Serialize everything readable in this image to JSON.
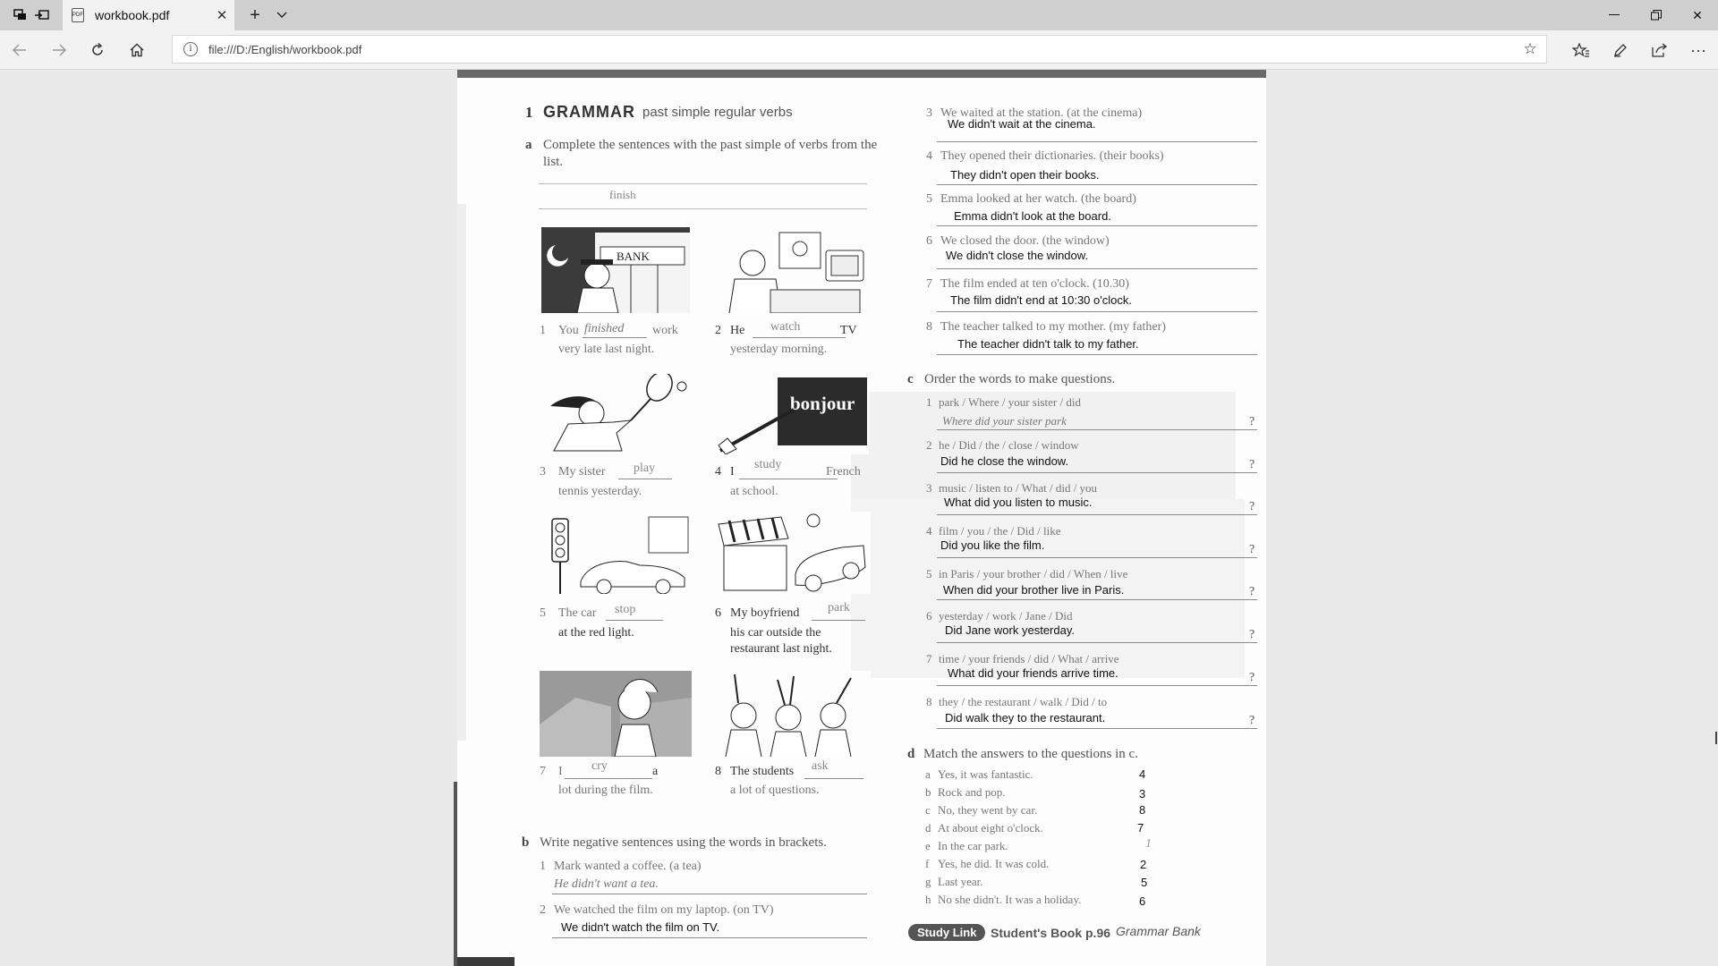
{
  "browser": {
    "tab_title": "workbook.pdf",
    "tab_favicon_text": "PDF",
    "url": "file:///D:/English/workbook.pdf"
  },
  "page": {
    "section1": {
      "number": "1",
      "heading": "GRAMMAR",
      "subheading": "past simple regular verbs",
      "part_a": {
        "letter": "a",
        "instruction": "Complete the sentences with the past simple of verbs from the list.",
        "word_box": [
          "finish"
        ],
        "items": [
          {
            "num": "1",
            "pre": "You",
            "fill": "finished",
            "post": "work",
            "line2": "very late last night."
          },
          {
            "num": "2",
            "pre": "He",
            "fill": "watch",
            "post": "TV",
            "line2": "yesterday morning."
          },
          {
            "num": "3",
            "pre": "My sister",
            "fill": "play",
            "post": "",
            "line2": "tennis yesterday."
          },
          {
            "num": "4",
            "pre": "I",
            "fill": "study",
            "post": "French",
            "line2": "at school."
          },
          {
            "num": "5",
            "pre": "The car",
            "fill": "stop",
            "post": "",
            "line2": "at the red light."
          },
          {
            "num": "6",
            "pre": "My boyfriend",
            "fill": "park",
            "post": "",
            "line2": "his car outside the",
            "line3": "restaurant last night."
          },
          {
            "num": "7",
            "pre": "I",
            "fill": "cry",
            "post": "a",
            "line2": "lot during the film."
          },
          {
            "num": "8",
            "pre": "The students",
            "fill": "ask",
            "post": "",
            "line2": "a lot of questions."
          }
        ],
        "bonjour_sign": "bonjour",
        "bank_sign": "BANK"
      },
      "part_b": {
        "letter": "b",
        "instruction": "Write negative sentences using the words in brackets.",
        "items": [
          {
            "num": "1",
            "prompt": "Mark wanted a coffee. (a tea)",
            "answer": "He didn't want a tea."
          },
          {
            "num": "2",
            "prompt": "We watched the film on my laptop. (on TV)",
            "answer": "We didn't watch the film on TV."
          },
          {
            "num": "3",
            "prompt": "We waited at the station. (at the cinema)",
            "answer": "We didn't wait      at the cinema."
          },
          {
            "num": "4",
            "prompt": "They opened their dictionaries. (their books)",
            "answer": "They didn't open their books."
          },
          {
            "num": "5",
            "prompt": "Emma looked at her watch. (the board)",
            "answer": "Emma didn't look at the board."
          },
          {
            "num": "6",
            "prompt": "We closed the door. (the window)",
            "answer": "We didn't close the window."
          },
          {
            "num": "7",
            "prompt": "The film ended at ten o'clock. (10.30)",
            "answer": "The film didn't end at 10:30 o'clock."
          },
          {
            "num": "8",
            "prompt": "The teacher talked to my mother. (my father)",
            "answer": "The teacher didn't talk to my father."
          }
        ]
      },
      "part_c": {
        "letter": "c",
        "instruction": "Order the words to make questions.",
        "items": [
          {
            "num": "1",
            "prompt": "park / Where / your sister / did",
            "answer": "Where did your sister park"
          },
          {
            "num": "2",
            "prompt": "he / Did / the / close / window",
            "answer": "Did he close the window."
          },
          {
            "num": "3",
            "prompt": "music / listen to / What / did / you",
            "answer": "What did you listen to music."
          },
          {
            "num": "4",
            "prompt": "film / you / the / Did / like",
            "answer": "Did you like the film."
          },
          {
            "num": "5",
            "prompt": "in Paris / your brother / did / When / live",
            "answer": "When did your brother live in Paris."
          },
          {
            "num": "6",
            "prompt": "yesterday / work / Jane / Did",
            "answer": "Did Jane work yesterday."
          },
          {
            "num": "7",
            "prompt": "time / your friends / did / What / arrive",
            "answer": "What did your friends arrive time."
          },
          {
            "num": "8",
            "prompt": "they / the restaurant / walk / Did / to",
            "answer": "Did walk they to the restaurant."
          }
        ],
        "qmark": "?"
      },
      "part_d": {
        "letter": "d",
        "instruction": "Match the answers to the questions in c.",
        "items": [
          {
            "letter": "a",
            "text": "Yes, it was fantastic.",
            "answer": "4"
          },
          {
            "letter": "b",
            "text": "Rock and pop.",
            "answer": "3"
          },
          {
            "letter": "c",
            "text": "No, they went by car.",
            "answer": "8"
          },
          {
            "letter": "d",
            "text": "At about eight o'clock.",
            "answer": "7"
          },
          {
            "letter": "e",
            "text": "In the car park.",
            "answer": "1"
          },
          {
            "letter": "f",
            "text": "Yes, he did. It was cold.",
            "answer": "2"
          },
          {
            "letter": "g",
            "text": "Last year.",
            "answer": "5"
          },
          {
            "letter": "h",
            "text": "No she didn't. It was a holiday.",
            "answer": "6"
          }
        ]
      },
      "study_link": {
        "badge": "Study Link",
        "text": "Student's Book p.96",
        "italic": "Grammar Bank"
      }
    }
  }
}
